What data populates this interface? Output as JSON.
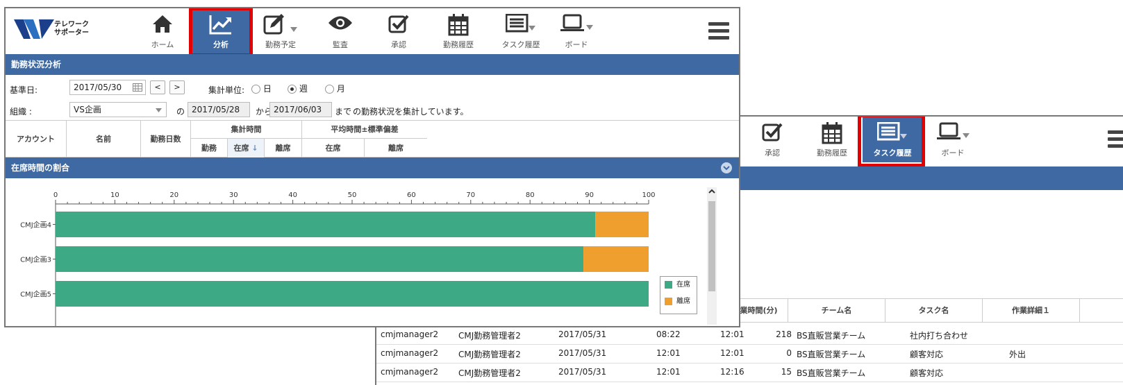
{
  "colors": {
    "brand": "#3e69a2",
    "present": "#3ea985",
    "away": "#ee9f2d",
    "highlight": "#e40000"
  },
  "logo": {
    "line1": "テレワーク",
    "line2": "サポーター"
  },
  "nav": {
    "home": "ホーム",
    "analysis": "分析",
    "schedule": "勤務予定",
    "monitor": "監査",
    "approve": "承認",
    "history": "勤務履歴",
    "task": "タスク履歴",
    "board": "ボード"
  },
  "panel": {
    "title": "勤務状況分析"
  },
  "filters": {
    "base_label": "基準日:",
    "base_date": "2017/05/30",
    "prev": "<",
    "next": ">",
    "unit_label": "集計単位:",
    "unit_day": "日",
    "unit_week": "週",
    "unit_month": "月",
    "org_label": "組織 :",
    "org_value": "VS企画",
    "of": "の",
    "from_date": "2017/05/28",
    "from_label": "から",
    "to_date": "2017/06/03",
    "to_label": "まで",
    "summary": "の勤務状況を集計しています。"
  },
  "table_header": {
    "account": "アカウント",
    "name": "名前",
    "days": "勤務日数",
    "total": "集計時間",
    "work": "勤務",
    "present": "在席",
    "sort_arrow": "↓",
    "away": "離席",
    "avg": "平均時間±標準偏差",
    "avg_present": "在席",
    "avg_away": "離席"
  },
  "ratio_panel": {
    "title": "在席時間の割合"
  },
  "chart_data": {
    "type": "bar",
    "orientation": "horizontal",
    "stacked": true,
    "categories": [
      "CMJ企画4",
      "CMJ企画3",
      "CMJ企画5"
    ],
    "series": [
      {
        "name": "在席",
        "values": [
          91,
          89,
          100
        ]
      },
      {
        "name": "離席",
        "values": [
          9,
          11,
          0
        ]
      }
    ],
    "xlim": [
      0,
      100
    ],
    "xticks": [
      0,
      10,
      20,
      30,
      40,
      50,
      60,
      70,
      80,
      90,
      100
    ],
    "legend": "bottom-right"
  },
  "task_table": {
    "headers": {
      "work_time": "作業時間(分)",
      "team": "チーム名",
      "task": "タスク名",
      "detail": "作業詳細１"
    },
    "rows": [
      {
        "account": "cmjmanager2",
        "name": "CMJ勤務管理者2",
        "date": "2017/05/31",
        "start": "08:22",
        "end": "12:01",
        "minutes": "218",
        "team": "BS直販営業チーム",
        "task": "社内打ち合わせ",
        "detail": ""
      },
      {
        "account": "cmjmanager2",
        "name": "CMJ勤務管理者2",
        "date": "2017/05/31",
        "start": "12:01",
        "end": "12:01",
        "minutes": "0",
        "team": "BS直販営業チーム",
        "task": "顧客対応",
        "detail": "外出"
      },
      {
        "account": "cmjmanager2",
        "name": "CMJ勤務管理者2",
        "date": "2017/05/31",
        "start": "12:01",
        "end": "12:16",
        "minutes": "15",
        "team": "BS直販営業チーム",
        "task": "顧客対応",
        "detail": ""
      }
    ]
  }
}
